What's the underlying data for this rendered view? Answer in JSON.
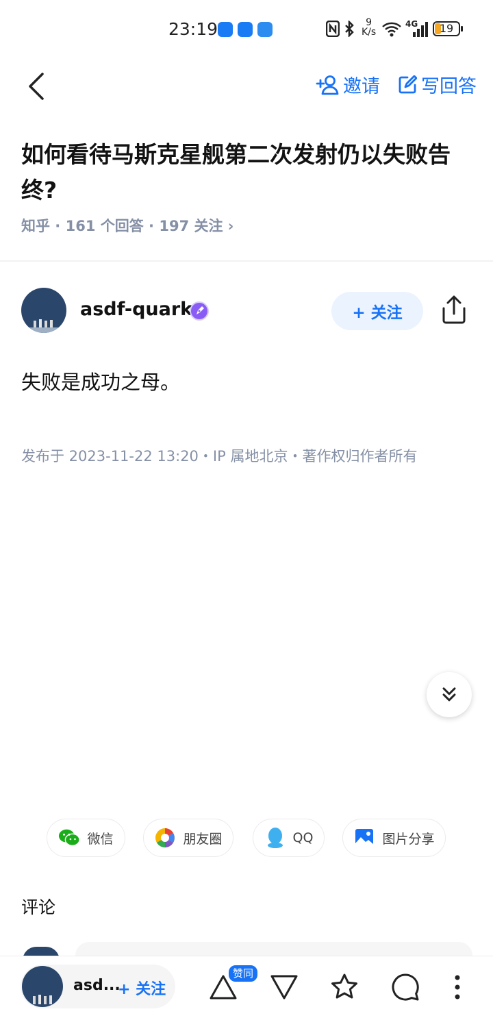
{
  "status_bar": {
    "time": "23:19",
    "net_speed_value": "9",
    "net_speed_unit": "K/s",
    "network": "4G",
    "battery": "19"
  },
  "header": {
    "invite_label": "邀请",
    "write_answer_label": "写回答"
  },
  "question": {
    "title": "如何看待马斯克星舰第二次发射仍以失败告终?",
    "meta": "知乎 · 161 个回答 · 197 关注 ›"
  },
  "answer": {
    "author": "asdf-quark",
    "follow_label": "+ 关注",
    "content": "失败是成功之母。",
    "meta": "发布于 2023-11-22 13:20・IP 属地北京・著作权归作者所有"
  },
  "share": {
    "wechat": "微信",
    "moments": "朋友圈",
    "qq": "QQ",
    "image": "图片分享"
  },
  "comments": {
    "title": "评论"
  },
  "bottom_bar": {
    "author_short": "asd...",
    "follow_label": "+ 关注",
    "vote_badge": "赞同"
  },
  "colors": {
    "accent": "#1772f6",
    "meta_gray": "#8590a6",
    "avatar_bg": "#2b466b"
  }
}
